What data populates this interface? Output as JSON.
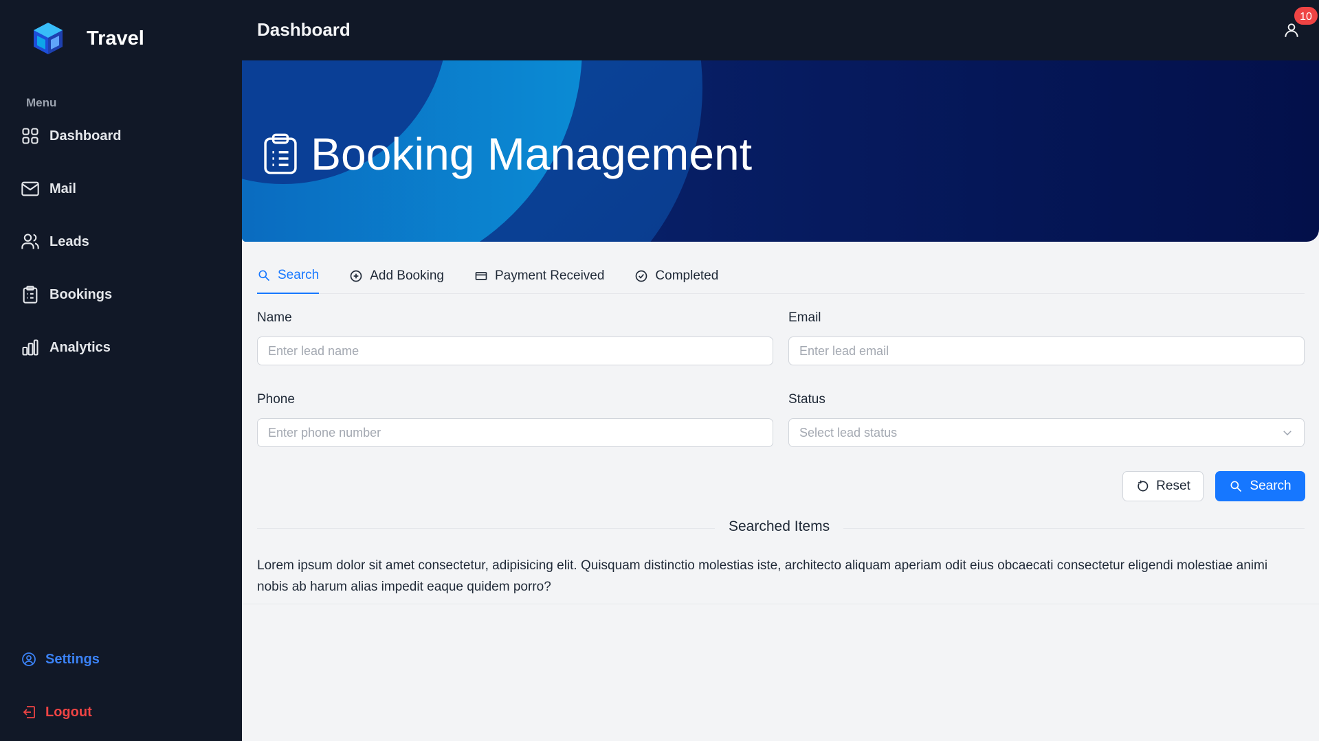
{
  "sidebar": {
    "brand": "Travel",
    "menu_heading": "Menu",
    "items": [
      {
        "label": "Dashboard",
        "icon": "grid-icon"
      },
      {
        "label": "Mail",
        "icon": "mail-icon"
      },
      {
        "label": "Leads",
        "icon": "users-icon"
      },
      {
        "label": "Bookings",
        "icon": "clipboard-icon"
      },
      {
        "label": "Analytics",
        "icon": "bar-chart-icon"
      }
    ],
    "settings": "Settings",
    "logout": "Logout"
  },
  "header": {
    "title": "Dashboard",
    "notification_count": "10"
  },
  "banner": {
    "title": "Booking Management"
  },
  "tabs": [
    {
      "label": "Search",
      "icon": "search-icon",
      "active": true
    },
    {
      "label": "Add Booking",
      "icon": "plus-circle-icon",
      "active": false
    },
    {
      "label": "Payment Received",
      "icon": "credit-card-icon",
      "active": false
    },
    {
      "label": "Completed",
      "icon": "check-circle-icon",
      "active": false
    }
  ],
  "form": {
    "name": {
      "label": "Name",
      "placeholder": "Enter lead name"
    },
    "email": {
      "label": "Email",
      "placeholder": "Enter lead email"
    },
    "phone": {
      "label": "Phone",
      "placeholder": "Enter phone number"
    },
    "status": {
      "label": "Status",
      "placeholder": "Select lead status"
    },
    "reset_label": "Reset",
    "search_label": "Search"
  },
  "results": {
    "title": "Searched Items",
    "text": "Lorem ipsum dolor sit amet consectetur, adipisicing elit. Quisquam distinctio molestias iste, architecto aliquam aperiam odit eius obcaecati consectetur eligendi molestiae animi nobis ab harum alias impedit eaque quidem porro?"
  },
  "colors": {
    "sidebar_bg": "#111827",
    "accent": "#1677ff",
    "danger": "#ef4444"
  }
}
